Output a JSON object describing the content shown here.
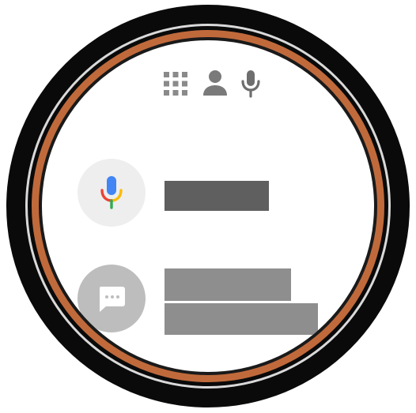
{
  "watch": {
    "accent_copper": "#c06a3c",
    "bezel_color": "#0a0a0a"
  },
  "top_bar": {
    "icons": [
      "apps-grid-icon",
      "account-icon",
      "microphone-icon"
    ]
  },
  "voice_row": {
    "icon": "google-mic-icon",
    "query_text": ""
  },
  "message_row": {
    "icon": "chat-bubble-icon",
    "line_1": "",
    "line_2": ""
  },
  "colors": {
    "mic_blue": "#4285f4",
    "mic_red": "#ea4335",
    "mic_yellow": "#fbbc05",
    "mic_green": "#34a853",
    "icon_gray": "#7a7a7a"
  }
}
